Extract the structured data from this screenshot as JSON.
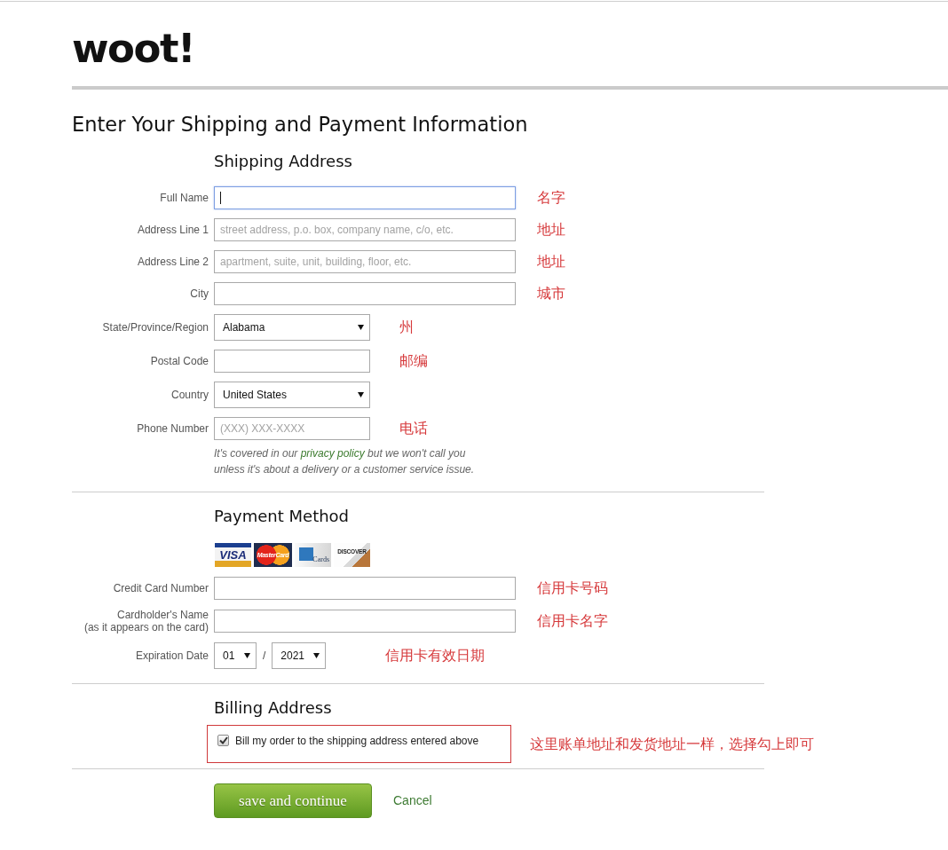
{
  "logo": {
    "text": "woot!"
  },
  "title": "Enter Your Shipping and Payment Information",
  "sections": [
    {
      "heading": "Shipping Address",
      "fields": [
        {
          "kind": "wide",
          "label": "Full Name",
          "focused": true,
          "note": "名字"
        },
        {
          "kind": "wide",
          "label": "Address Line 1",
          "placeholder": "street address, p.o. box, company name, c/o, etc.",
          "focused": false,
          "note": "地址"
        },
        {
          "kind": "wide",
          "label": "Address Line 2",
          "placeholder": "apartment, suite, unit, building, floor, etc.",
          "focused": false,
          "note": "地址"
        },
        {
          "kind": "wide",
          "label": "City",
          "focused": false,
          "note": "城市"
        },
        {
          "kind": "dropdown",
          "label": "State/Province/Region",
          "value": "Alabama",
          "note": "州"
        },
        {
          "kind": "narrow",
          "label": "Postal Code",
          "focused": false,
          "note": "邮编"
        },
        {
          "kind": "dropdown",
          "label": "Country",
          "value": "United States"
        },
        {
          "kind": "narrow",
          "label": "Phone Number",
          "placeholder": "(XXX) XXX-XXXX",
          "focused": false,
          "note": "电话"
        }
      ],
      "help": {
        "before": "It's covered in our ",
        "link": "privacy policy",
        "after": " but we won't call you unless it's about a delivery or a customer service issue."
      }
    },
    {
      "heading": "Payment Method",
      "cards": [
        {
          "kind": "visa",
          "text": "VISA"
        },
        {
          "kind": "mastercard",
          "text": "MasterCard"
        },
        {
          "kind": "amex",
          "text": "Cards"
        },
        {
          "kind": "discover",
          "text": "DISCOVER"
        }
      ],
      "fields": [
        {
          "kind": "wide",
          "label": "Credit Card Number",
          "focused": false,
          "note": "信用卡号码"
        },
        {
          "kind": "wide",
          "label": "Cardholder's Name",
          "sublabel": "(as it appears on the card)",
          "focused": false,
          "note": "信用卡名字"
        },
        {
          "kind": "expiry",
          "label": "Expiration Date",
          "month": "01",
          "separator": "/",
          "year": "2021",
          "note": "信用卡有效日期"
        }
      ]
    },
    {
      "heading": "Billing Address",
      "option": {
        "label": "Bill my order to the shipping address entered above",
        "checked": true
      },
      "note": "这里账单地址和发货地址一样，选择勾上即可"
    }
  ],
  "actions": {
    "submit": "save and continue",
    "cancel": "Cancel"
  }
}
